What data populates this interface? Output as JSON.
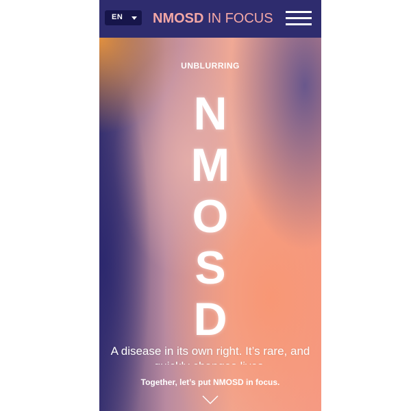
{
  "header": {
    "language": "EN",
    "brand_bold": "NMOSD",
    "brand_light": " IN FOCUS"
  },
  "hero": {
    "eyebrow": "UNBLURRING",
    "title_letters": [
      "N",
      "M",
      "O",
      "S",
      "D"
    ],
    "tagline": "A disease in its own right. It’s rare, and quickly changes lives.",
    "cta": "Together, let’s put NMOSD in focus."
  },
  "colors": {
    "nav_background": "#2e2c6e",
    "language_selector": "#16154a",
    "brand_text": "#f4a8a6",
    "hero_text": "#ffffff"
  },
  "icons": {
    "menu": "hamburger-menu-icon",
    "language_caret": "caret-down-icon",
    "scroll": "chevron-down-icon"
  }
}
